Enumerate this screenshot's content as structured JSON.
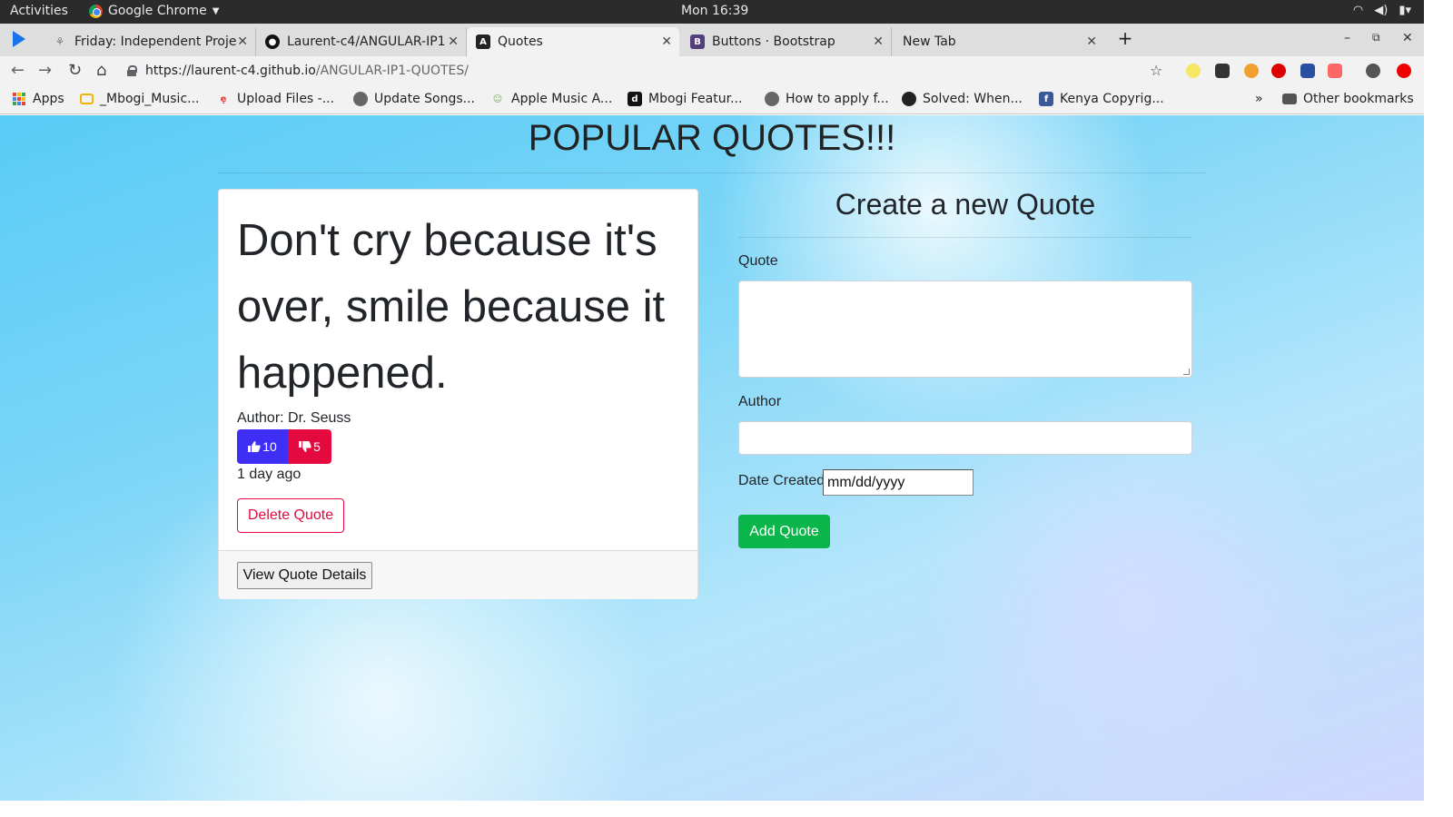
{
  "system_bar": {
    "activities": "Activities",
    "app_name": "Google Chrome",
    "clock": "Mon 16:39"
  },
  "tabs": [
    {
      "title": "Friday: Independent Proje",
      "favicon": "plant-icon"
    },
    {
      "title": "Laurent-c4/ANGULAR-IP1",
      "favicon": "github-icon"
    },
    {
      "title": "Quotes",
      "favicon": "angular-icon",
      "active": true
    },
    {
      "title": "Buttons · Bootstrap",
      "favicon": "bootstrap-icon"
    },
    {
      "title": "New Tab",
      "favicon": ""
    }
  ],
  "address_bar": {
    "host": "https://laurent-c4.github.io",
    "path": "/ANGULAR-IP1-QUOTES/"
  },
  "bookmarks": {
    "items": [
      {
        "label": "Apps"
      },
      {
        "label": "_Mbogi_Music..."
      },
      {
        "label": "Upload Files -..."
      },
      {
        "label": "Update Songs..."
      },
      {
        "label": "Apple Music A..."
      },
      {
        "label": "Mbogi Featur..."
      },
      {
        "label": "How to apply f..."
      },
      {
        "label": "Solved: When..."
      },
      {
        "label": "Kenya Copyrig..."
      }
    ],
    "overflow": "»",
    "other": "Other bookmarks"
  },
  "page": {
    "title": "POPULAR QUOTES!!!",
    "quote_card": {
      "text": "Don't cry because it's over, smile because it happened.",
      "author": "Author: Dr. Seuss",
      "upvotes": "10",
      "downvotes": "5",
      "age": "1 day ago",
      "delete_label": "Delete Quote",
      "details_label": "View Quote Details"
    },
    "form": {
      "heading": "Create a new Quote",
      "quote_label": "Quote",
      "author_label": "Author",
      "date_label": "Date Created",
      "date_placeholder": "mm/dd/yyyy",
      "submit_label": "Add Quote"
    },
    "colors": {
      "upvote": "#3f2ff5",
      "downvote": "#e4093f",
      "add_button": "#0ab64a"
    }
  }
}
